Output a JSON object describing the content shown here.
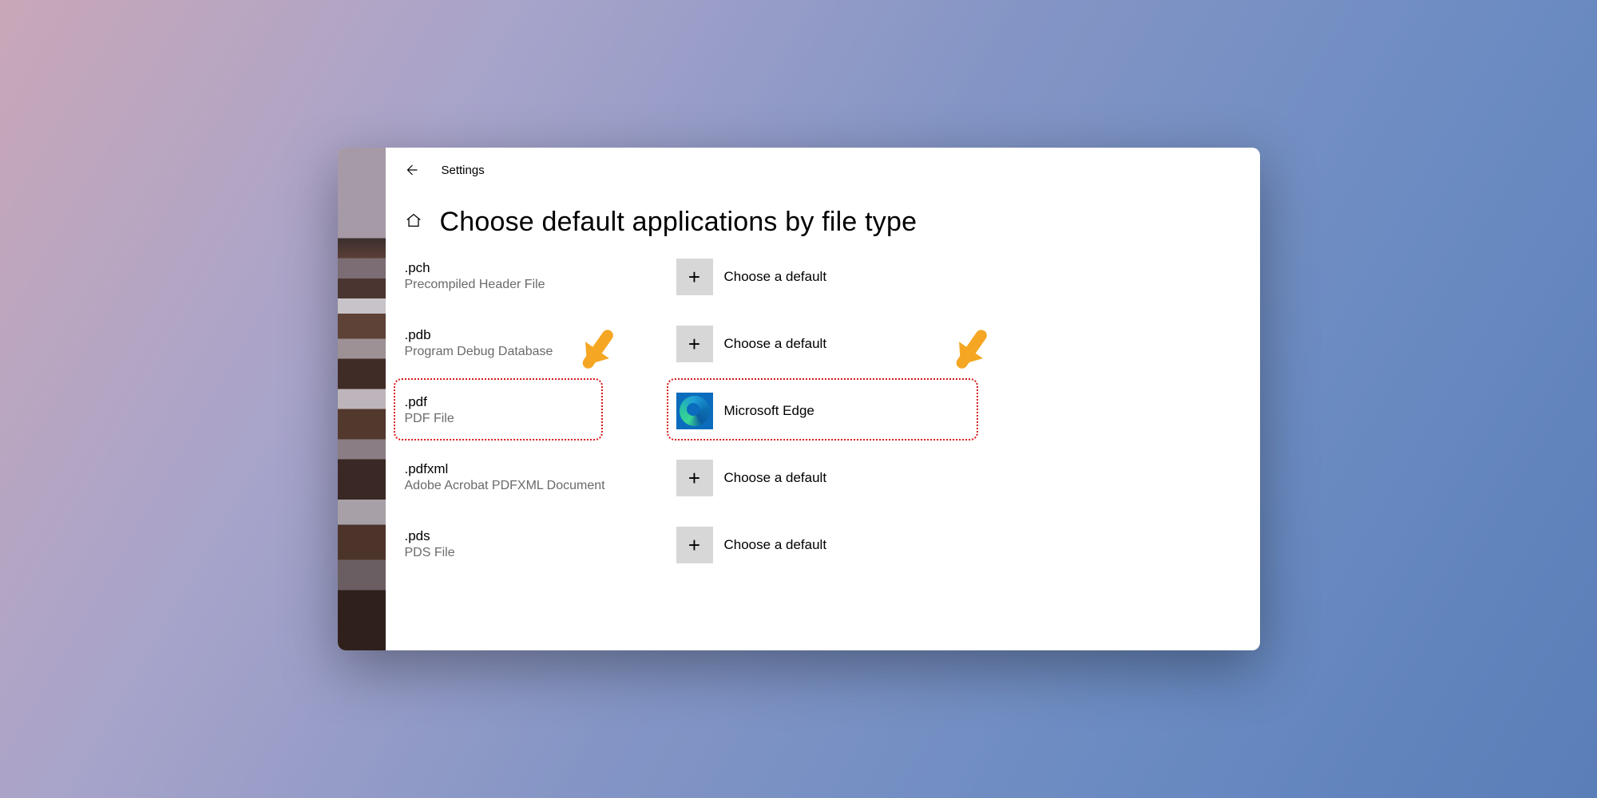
{
  "topbar": {
    "title": "Settings"
  },
  "page": {
    "title": "Choose default applications by file type"
  },
  "default_choose_label": "Choose a default",
  "rows": [
    {
      "ext": ".pch",
      "desc": "Precompiled Header File",
      "app": null
    },
    {
      "ext": ".pdb",
      "desc": "Program Debug Database",
      "app": null
    },
    {
      "ext": ".pdf",
      "desc": "PDF File",
      "app": "Microsoft Edge"
    },
    {
      "ext": ".pdfxml",
      "desc": "Adobe Acrobat PDFXML Document",
      "app": null
    },
    {
      "ext": ".pds",
      "desc": "PDS File",
      "app": null
    }
  ],
  "annotations": {
    "highlight_row_index": 2,
    "arrow_color": "#f5a623",
    "dotted_color": "#d61a1a"
  }
}
